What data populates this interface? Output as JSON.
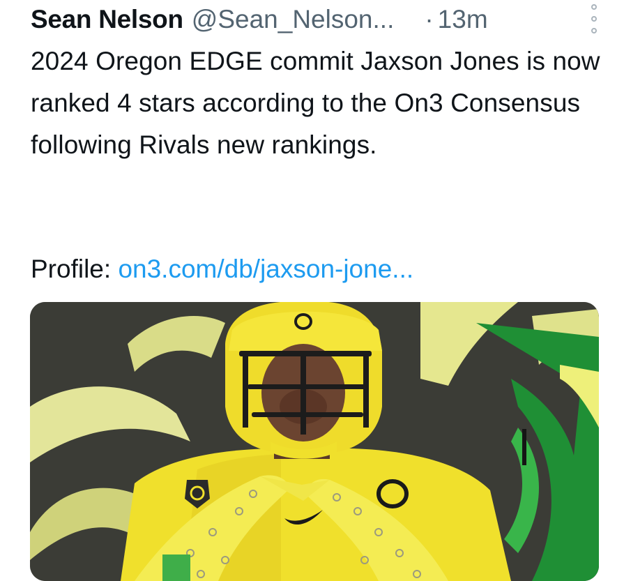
{
  "tweet": {
    "author_name": "Sean Nelson",
    "author_handle": "@Sean_Nelson...",
    "separator": "·",
    "time": "13m",
    "more_icon": "vertical-dots-icon",
    "text": "2024 Oregon EDGE commit Jaxson Jones is now ranked 4 stars according to the On3 Consensus following Rivals new rankings.",
    "profile_label": "Profile:",
    "profile_link": "on3.com/db/jaxson-jone..."
  },
  "media": {
    "jersey_letter": "O",
    "helmet_letter": "O"
  },
  "colors": {
    "link": "#1d9bf0",
    "secondary_text": "#536471",
    "oregon_yellow": "#f2e33a",
    "oregon_green": "#1f9a3a"
  }
}
